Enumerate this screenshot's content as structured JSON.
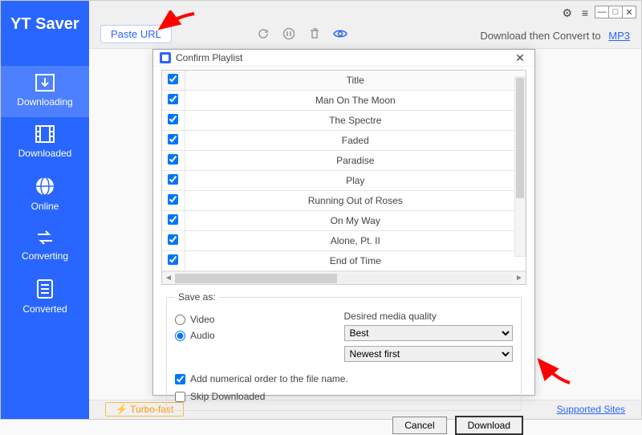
{
  "app": {
    "name": "YT Saver"
  },
  "toolbar": {
    "paste_url": "Paste URL",
    "download_convert": "Download then Convert to",
    "format_link": "MP3"
  },
  "sidebar": {
    "items": [
      {
        "label": "Downloading"
      },
      {
        "label": "Downloaded"
      },
      {
        "label": "Online"
      },
      {
        "label": "Converting"
      },
      {
        "label": "Converted"
      }
    ]
  },
  "footer": {
    "turbo": "⚡ Turbo-fast",
    "supported": "Supported Sites"
  },
  "dialog": {
    "title": "Confirm Playlist",
    "header_title": "Title",
    "rows": [
      {
        "title": "Man On The Moon",
        "checked": true
      },
      {
        "title": "The Spectre",
        "checked": true
      },
      {
        "title": "Faded",
        "checked": true
      },
      {
        "title": "Paradise",
        "checked": true
      },
      {
        "title": "Play",
        "checked": true
      },
      {
        "title": "Running Out of Roses",
        "checked": true
      },
      {
        "title": "On My Way",
        "checked": true
      },
      {
        "title": "Alone, Pt. II",
        "checked": true
      },
      {
        "title": "End of Time",
        "checked": true
      }
    ],
    "save_as_legend": "Save as:",
    "video_label": "Video",
    "audio_label": "Audio",
    "dmq_label": "Desired media quality",
    "quality": "Best",
    "order": "Newest first",
    "numerical": "Add numerical order to the file name.",
    "skip": "Skip Downloaded",
    "cancel": "Cancel",
    "download": "Download"
  }
}
